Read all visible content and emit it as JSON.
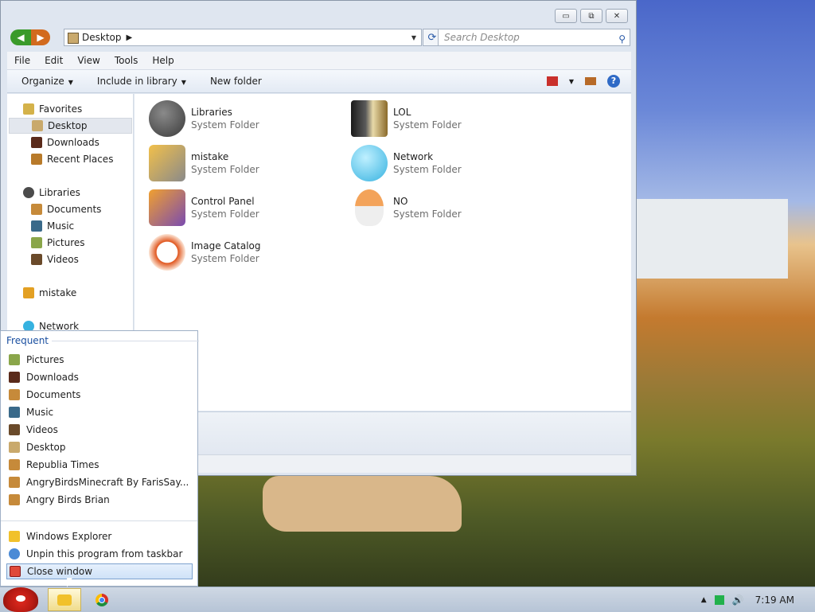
{
  "explorer": {
    "address": {
      "location": "Desktop"
    },
    "search": {
      "placeholder": "Search Desktop"
    },
    "caption": {
      "minimize": "▭",
      "maximize": "⧉",
      "close": "✕"
    },
    "menu": [
      "File",
      "Edit",
      "View",
      "Tools",
      "Help"
    ],
    "toolbar": {
      "organize": "Organize",
      "include_in_library": "Include in library",
      "new_folder": "New folder",
      "help": "?"
    },
    "nav": {
      "favorites": "Favorites",
      "desktop": "Desktop",
      "downloads": "Downloads",
      "recent_places": "Recent Places",
      "libraries": "Libraries",
      "documents": "Documents",
      "music": "Music",
      "pictures": "Pictures",
      "videos": "Videos",
      "mistake": "mistake",
      "network": "Network"
    },
    "items": [
      {
        "name": "Libraries",
        "type": "System Folder",
        "icon": "libraries-icon",
        "color": "#4b4b4b"
      },
      {
        "name": "LOL",
        "type": "System Folder",
        "icon": "lol-folder-icon",
        "color": "#2a2a2a"
      },
      {
        "name": "mistake",
        "type": "System Folder",
        "icon": "user-computer-icon",
        "color": "#e3a023"
      },
      {
        "name": "Network",
        "type": "System Folder",
        "icon": "network-globe-icon",
        "color": "#36b2e0"
      },
      {
        "name": "Control Panel",
        "type": "System Folder",
        "icon": "control-panel-icon",
        "color": "#7a4bb0"
      },
      {
        "name": "NO",
        "type": "System Folder",
        "icon": "egg-icon",
        "color": "#e7883a"
      },
      {
        "name": "Image Catalog",
        "type": "System Folder",
        "icon": "lightning-icon",
        "color": "#e0561e"
      }
    ]
  },
  "jumplist": {
    "header": "Frequent",
    "frequent": [
      {
        "label": "Pictures",
        "icon": "pictures-icon"
      },
      {
        "label": "Downloads",
        "icon": "downloads-icon"
      },
      {
        "label": "Documents",
        "icon": "documents-icon"
      },
      {
        "label": "Music",
        "icon": "music-icon"
      },
      {
        "label": "Videos",
        "icon": "videos-icon"
      },
      {
        "label": "Desktop",
        "icon": "desktop-icon"
      },
      {
        "label": "Republia Times",
        "icon": "folder-icon"
      },
      {
        "label": "AngryBirdsMinecraft By FarisSay...",
        "icon": "folder-icon"
      },
      {
        "label": "Angry Birds Brian",
        "icon": "folder-icon"
      }
    ],
    "tasks": [
      {
        "label": "Windows Explorer",
        "icon": "explorer-icon"
      },
      {
        "label": "Unpin this program from taskbar",
        "icon": "unpin-icon"
      },
      {
        "label": "Close window",
        "icon": "close-window-icon"
      }
    ]
  },
  "taskbar": {
    "clock": "7:19 AM"
  }
}
